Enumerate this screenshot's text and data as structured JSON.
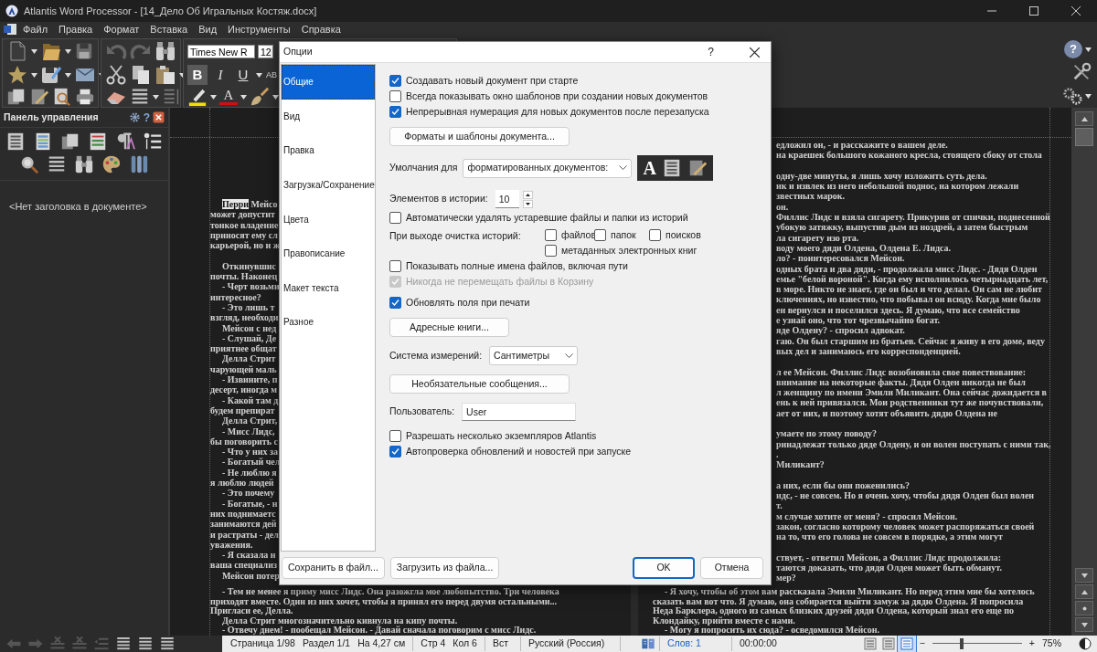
{
  "window": {
    "title": "Atlantis Word Processor - [14_Дело Об Игральных Костяж.docx]"
  },
  "menu": [
    "Файл",
    "Правка",
    "Формат",
    "Вставка",
    "Вид",
    "Инструменты",
    "Справка"
  ],
  "toolbar": {
    "font_name": "Times New R",
    "font_size": "12",
    "format_buttons": [
      {
        "label": "B",
        "selected": true
      },
      {
        "label": "I",
        "selected": false
      },
      {
        "label": "U",
        "selected": false
      },
      {
        "label": "AB",
        "selected": false
      }
    ],
    "font_color_glyph": "A",
    "help_glyph": "?"
  },
  "control_panel": {
    "title": "Панель управления",
    "help_glyph": "?",
    "outline_placeholder": "<Нет заголовка в документе>"
  },
  "document": {
    "left_page": [
      {
        "kind": "indent",
        "highlight": "Перри",
        "text": "Мейсо"
      },
      {
        "kind": "text",
        "text": "может допустит"
      },
      {
        "kind": "text",
        "text": "тонкое владение"
      },
      {
        "kind": "text",
        "text": "приносят ему сл"
      },
      {
        "kind": "text",
        "text": "карьерой, но и ж"
      },
      {
        "kind": "blank"
      },
      {
        "kind": "indent",
        "text": "Откинувшис"
      },
      {
        "kind": "text",
        "text": "почты. Наконец"
      },
      {
        "kind": "indent",
        "text": "- Черт возьми"
      },
      {
        "kind": "text",
        "text": "интересное?"
      },
      {
        "kind": "indent",
        "text": "- Это лишь т"
      },
      {
        "kind": "text",
        "text": "взгляд, необходи"
      },
      {
        "kind": "indent",
        "text": "Мейсон с нед"
      },
      {
        "kind": "indent",
        "text": "- Слушай, Де"
      },
      {
        "kind": "text",
        "text": "приятнее общат"
      },
      {
        "kind": "indent",
        "text": "Делла Стрит"
      },
      {
        "kind": "text",
        "text": "чарующей маль"
      },
      {
        "kind": "indent",
        "text": "- Извините, п"
      },
      {
        "kind": "text",
        "text": "десерт, иногда м"
      },
      {
        "kind": "indent",
        "text": "- Какой там д"
      },
      {
        "kind": "text",
        "text": "будем препират"
      },
      {
        "kind": "indent",
        "text": "Делла Стрит,"
      },
      {
        "kind": "indent",
        "text": "- Мисс Лидс,"
      },
      {
        "kind": "text",
        "text": "бы поговорить с"
      },
      {
        "kind": "indent",
        "text": "- Что у них за"
      },
      {
        "kind": "indent",
        "text": "- Богатый чел"
      },
      {
        "kind": "indent",
        "text": "- Не люблю я"
      },
      {
        "kind": "text",
        "text": "я люблю людей"
      },
      {
        "kind": "indent",
        "text": "- Это почему"
      },
      {
        "kind": "indent",
        "text": "- Богатые, - н"
      },
      {
        "kind": "text",
        "text": "них поднимаетс"
      },
      {
        "kind": "text",
        "text": "занимаются дей"
      },
      {
        "kind": "text",
        "text": "и растраты - дел"
      },
      {
        "kind": "text",
        "text": "уважения."
      },
      {
        "kind": "indent",
        "text": "- Я сказала н"
      },
      {
        "kind": "text",
        "text": "ваша специализ"
      },
      {
        "kind": "indent",
        "text": "Мейсон потер"
      }
    ],
    "left_page_bottom": [
      {
        "kind": "indent",
        "text": "- Тем не менее я приму мисс Лидс. Она разожгла мое любопытство. Три человека"
      },
      {
        "kind": "text",
        "text": "приходят вместе. Один из них хочет, чтобы я принял его перед двумя остальными..."
      },
      {
        "kind": "text",
        "text": "Пригласи ее, Делла."
      },
      {
        "kind": "indent",
        "text": "Делла Стрит многозначительно кивнула на кипу почты."
      },
      {
        "kind": "indent",
        "text": "- Отвечу днем! - пообещал Мейсон. - Давай сначала поговорим с мисс Лидс."
      }
    ],
    "right_page_top": [
      {
        "kind": "text",
        "text": "едложил он, - и расскажите о вашем деле."
      },
      {
        "kind": "text",
        "text": "на краешек большого кожаного кресла, стоящего сбоку от стола"
      },
      {
        "kind": "blank"
      },
      {
        "kind": "text",
        "text": "одну-две минуты, я лишь хочу изложить суть дела."
      },
      {
        "kind": "text",
        "text": "ик и извлек из него небольшой поднос, на котором лежали"
      },
      {
        "kind": "text",
        "text": "звестных марок."
      },
      {
        "kind": "text",
        "text": "он."
      },
      {
        "kind": "text",
        "text": "Филлис Лидс и взяла сигарету. Прикурив от спички, поднесенной"
      },
      {
        "kind": "text",
        "text": "убокую затяжку, выпустив дым из ноздрей, а затем быстрым"
      },
      {
        "kind": "text",
        "text": "ла сигарету изо рта."
      },
      {
        "kind": "text",
        "text": "воду моего дяди Олдена, Олдена Е. Лидса."
      },
      {
        "kind": "text",
        "text": "ло? - поинтересовался Мейсон."
      },
      {
        "kind": "text",
        "text": "одных брата и два дяди, - продолжала мисс Лидс. - Дядя Олден"
      },
      {
        "kind": "text",
        "text": "емье \"белой вороной\". Когда ему исполнилось четырнадцать лет,"
      },
      {
        "kind": "text",
        "text": "в море. Никто не знает, где он был и что делал. Он сам не любит"
      },
      {
        "kind": "text",
        "text": "ключениях, но известно, что побывал он всюду. Когда мне было"
      },
      {
        "kind": "text",
        "text": "ен вернулся и поселился здесь. Я думаю, что все семейство"
      },
      {
        "kind": "text",
        "text": "е узнай оно, что тот чрезвычайно богат."
      },
      {
        "kind": "text",
        "text": "яде Олдену? - спросил адвокат."
      },
      {
        "kind": "text",
        "text": "гаю. Он был старшим из братьев. Сейчас я живу в его доме, веду"
      },
      {
        "kind": "text",
        "text": "вых дел и занимаюсь его корреспонденцией."
      },
      {
        "kind": "blank"
      },
      {
        "kind": "text",
        "text": "л ее Мейсон. Филлис Лидс возобновила свое повествование:"
      },
      {
        "kind": "text",
        "text": "внимание на некоторые факты. Дядя Олден никогда не был"
      },
      {
        "kind": "text",
        "text": "л женщину по имени Эмили Миликант. Она сейчас дожидается в"
      },
      {
        "kind": "text",
        "text": "ень к ней привязался. Мои родственники тут же почувствовали,"
      },
      {
        "kind": "text",
        "text": "ает от них, и поэтому хотят объявить дядю Олдена не"
      },
      {
        "kind": "blank"
      },
      {
        "kind": "text",
        "text": "умаете по этому поводу?"
      },
      {
        "kind": "text",
        "text": "ринадлежат только дяде Олдену, и он волен поступать с ними так,"
      },
      {
        "kind": "text",
        "text": "."
      },
      {
        "kind": "text",
        "text": "Миликант?"
      },
      {
        "kind": "blank"
      },
      {
        "kind": "text",
        "text": "а них, если бы они поженились?"
      },
      {
        "kind": "text",
        "text": "идс, - не совсем. Но я очень хочу, чтобы дядя Олден был волен"
      },
      {
        "kind": "text",
        "text": "т."
      },
      {
        "kind": "text",
        "text": "м случае хотите от меня? - спросил Мейсон."
      },
      {
        "kind": "text",
        "text": "закон, согласно которому человек может распоряжаться своей"
      },
      {
        "kind": "text",
        "text": "на то, что его голова не совсем в порядке, а этим могут"
      },
      {
        "kind": "blank"
      },
      {
        "kind": "text",
        "text": "ствует, - ответил Мейсон, а Филлис Лидс продолжила:"
      },
      {
        "kind": "text",
        "text": "таются доказать, что дядя Олден может быть обманут."
      },
      {
        "kind": "text",
        "text": "мер?"
      }
    ],
    "right_page_bottom": [
      {
        "kind": "indent",
        "text": "- Я хочу, чтобы об этом вам рассказала Эмили Миликант. Но перед этим мне бы хотелось"
      },
      {
        "kind": "text",
        "text": "сказать вам вот что. Я думаю, она собирается выйти замуж за дядю Олдена. Я попросила"
      },
      {
        "kind": "text",
        "text": "Неда Барклера, одного из самых близких друзей дяди Олдена, который знал его еще по"
      },
      {
        "kind": "text",
        "text": "Клондайку, прийти вместе с нами."
      },
      {
        "kind": "indent",
        "text": "- Могу я попросить их сюда? - осведомился Мейсон."
      }
    ]
  },
  "status_bar": {
    "cells": [
      "Страница 1/98",
      "Раздел 1/1",
      "На 4,27 см",
      "Стр 4",
      "Кол 6",
      "Вст",
      "Русский (Россия)"
    ],
    "words": "Слов: 1",
    "time": "00:00:00",
    "views": [
      {
        "selected": false
      },
      {
        "selected": false
      },
      {
        "selected": true
      }
    ],
    "zoom_minus": "−",
    "zoom_plus": "+",
    "zoom_slider": {
      "level": 0.32
    },
    "zoom": "75%"
  },
  "dialog": {
    "title": "Опции",
    "help": "?",
    "nav": [
      {
        "label": "Общие",
        "selected": true
      },
      {
        "label": "Вид",
        "selected": false
      },
      {
        "label": "Правка",
        "selected": false
      },
      {
        "label": "Загрузка/Сохранение",
        "selected": false
      },
      {
        "label": "Цвета",
        "selected": false
      },
      {
        "label": "Правописание",
        "selected": false
      },
      {
        "label": "Макет текста",
        "selected": false
      },
      {
        "label": "Разное",
        "selected": false
      }
    ],
    "sections": [
      [
        {
          "kind": "checkbox",
          "label": "Создавать новый документ при старте",
          "checked": true,
          "disabled": false
        },
        {
          "kind": "checkbox",
          "label": "Всегда показывать окно шаблонов при создании новых документов",
          "checked": false,
          "disabled": false
        },
        {
          "kind": "checkbox",
          "label": "Непрерывная нумерация для новых документов после перезапуска",
          "checked": true,
          "disabled": false
        }
      ],
      [
        {
          "kind": "button",
          "label": "Форматы и шаблоны документа..."
        }
      ],
      [
        {
          "kind": "select",
          "label": "Умолчания для",
          "value": "форматированных документов:",
          "glyph": "A"
        }
      ],
      [
        {
          "kind": "spin",
          "label": "Элементов в истории:",
          "value": "10"
        },
        {
          "kind": "checkbox",
          "label": "Автоматически удалять устаревшие файлы и папки из историй",
          "checked": false,
          "disabled": false
        },
        {
          "kind": "checkgroup",
          "label": "При выходе очистка историй:",
          "options": [
            {
              "label": "файлов",
              "checked": false
            },
            {
              "label": "папок",
              "checked": false
            },
            {
              "label": "поисков",
              "checked": false
            },
            {
              "label": "метаданных электронных книг",
              "checked": false
            }
          ]
        },
        {
          "kind": "checkbox",
          "label": "Показывать полные имена файлов, включая пути",
          "checked": false,
          "disabled": false
        },
        {
          "kind": "checkbox",
          "label": "Никогда не перемещать файлы в Корзину",
          "checked": true,
          "disabled": true
        }
      ],
      [
        {
          "kind": "checkbox",
          "label": "Обновлять поля при печати",
          "checked": true,
          "disabled": false
        }
      ],
      [
        {
          "kind": "button",
          "label": "Адресные книги..."
        }
      ],
      [
        {
          "kind": "select",
          "label": "Система измерений:",
          "value": "Сантиметры"
        }
      ],
      [
        {
          "kind": "button",
          "label": "Необязательные сообщения..."
        }
      ],
      [
        {
          "kind": "input",
          "label": "Пользователь:",
          "value": "User"
        }
      ],
      [
        {
          "kind": "checkbox",
          "label": "Разрешать несколько экземпляров Atlantis",
          "checked": false,
          "disabled": false
        },
        {
          "kind": "checkbox",
          "label": "Автопроверка обновлений и новостей при запуске",
          "checked": true,
          "disabled": false
        }
      ]
    ],
    "footer_buttons": [
      "Сохранить в файл...",
      "Загрузить из файла..."
    ],
    "ok": "OK",
    "cancel": "Отмена"
  }
}
